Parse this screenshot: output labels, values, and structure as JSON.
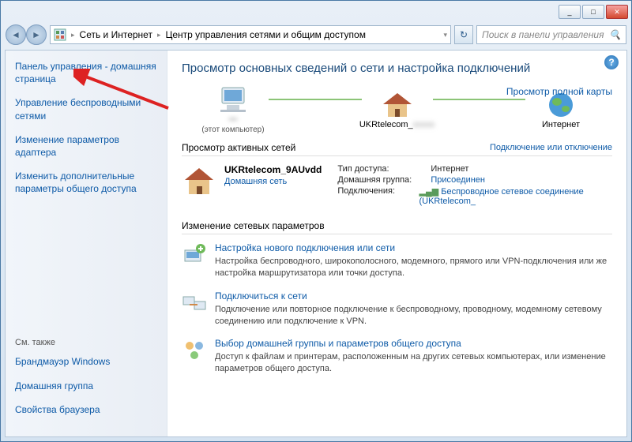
{
  "titlebar": {
    "min": "_",
    "max": "□",
    "close": "✕"
  },
  "addr": {
    "crumb1": "Сеть и Интернет",
    "crumb2": "Центр управления сетями и общим доступом",
    "search_placeholder": "Поиск в панели управления"
  },
  "sidebar": {
    "items": [
      "Панель управления - домашняя страница",
      "Управление беспроводными сетями",
      "Изменение параметров адаптера",
      "Изменить дополнительные параметры общего доступа"
    ],
    "seealso": "См. также",
    "bottom": [
      "Брандмауэр Windows",
      "Домашняя группа",
      "Свойства браузера"
    ]
  },
  "main": {
    "heading": "Просмотр основных сведений о сети и настройка подключений",
    "maplink": "Просмотр полной карты",
    "node1_label": "(этот компьютер)",
    "node1_name": "—",
    "node2_name": "UKRtelecom_",
    "node3_name": "Интернет",
    "sec_active": "Просмотр активных сетей",
    "sec_active_right": "Подключение или отключение",
    "net_name": "UKRtelecom_9AUvdd",
    "net_type": "Домашняя сеть",
    "kv": {
      "k1": "Тип доступа:",
      "v1": "Интернет",
      "k2": "Домашняя группа:",
      "v2": "Присоединен",
      "k3": "Подключения:",
      "v3": "Беспроводное сетевое соединение (UKRtelecom_"
    },
    "sec_change": "Изменение сетевых параметров",
    "tasks": [
      {
        "title": "Настройка нового подключения или сети",
        "desc": "Настройка беспроводного, широкополосного, модемного, прямого или VPN-подключения или же настройка маршрутизатора или точки доступа."
      },
      {
        "title": "Подключиться к сети",
        "desc": "Подключение или повторное подключение к беспроводному, проводному, модемному сетевому соединению или подключение к VPN."
      },
      {
        "title": "Выбор домашней группы и параметров общего доступа",
        "desc": "Доступ к файлам и принтерам, расположенным на других сетевых компьютерах, или изменение параметров общего доступа."
      }
    ]
  }
}
